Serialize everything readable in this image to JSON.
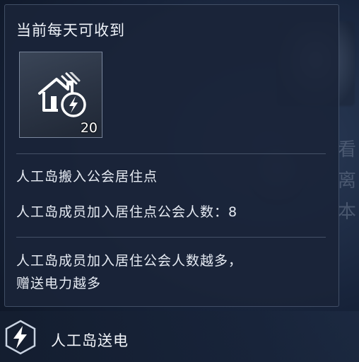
{
  "panel": {
    "title": "当前每天可收到",
    "item": {
      "icon": "house-electricity-icon",
      "quantity": "20"
    },
    "info": {
      "line1": "人工岛搬入公会居住点",
      "line2": "人工岛成员加入居住点公会人数：8"
    },
    "description": {
      "line1": "人工岛成员加入居住公会人数越多，",
      "line2": "赠送电力越多"
    }
  },
  "bottom_bar": {
    "icon": "lightning-badge-icon",
    "label": "人工岛送电"
  },
  "background": {
    "side_text": [
      "看",
      "离",
      "本"
    ]
  },
  "colors": {
    "panel_bg": "#1a2438",
    "text": "#e6ebf3",
    "border": "#8ca0be"
  }
}
